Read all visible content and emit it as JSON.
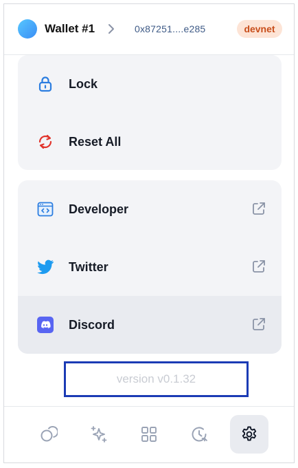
{
  "header": {
    "wallet_name": "Wallet #1",
    "address": "0x87251....e285",
    "network_badge": "devnet"
  },
  "menu_group_1": [
    {
      "label": "Lock",
      "icon": "lock-icon"
    },
    {
      "label": "Reset All",
      "icon": "refresh-icon"
    }
  ],
  "menu_group_2": [
    {
      "label": "Developer",
      "icon": "developer-icon",
      "external": true
    },
    {
      "label": "Twitter",
      "icon": "twitter-icon",
      "external": true
    },
    {
      "label": "Discord",
      "icon": "discord-icon",
      "external": true
    }
  ],
  "footer": {
    "version": "version v0.1.32"
  },
  "bottom_nav": [
    {
      "name": "assets",
      "icon": "coins-icon",
      "active": false
    },
    {
      "name": "sparkles",
      "icon": "sparkle-icon",
      "active": false
    },
    {
      "name": "apps",
      "icon": "grid-icon",
      "active": false
    },
    {
      "name": "history",
      "icon": "history-icon",
      "active": false
    },
    {
      "name": "settings",
      "icon": "gear-icon",
      "active": true
    }
  ],
  "colors": {
    "accent": "#1b3bb5",
    "badge_bg": "#fde4d6",
    "badge_text": "#c84e1b",
    "lock_icon": "#2b7de0",
    "reset_icon": "#e1342c",
    "twitter": "#1d9bf0",
    "discord": "#5865f2"
  }
}
